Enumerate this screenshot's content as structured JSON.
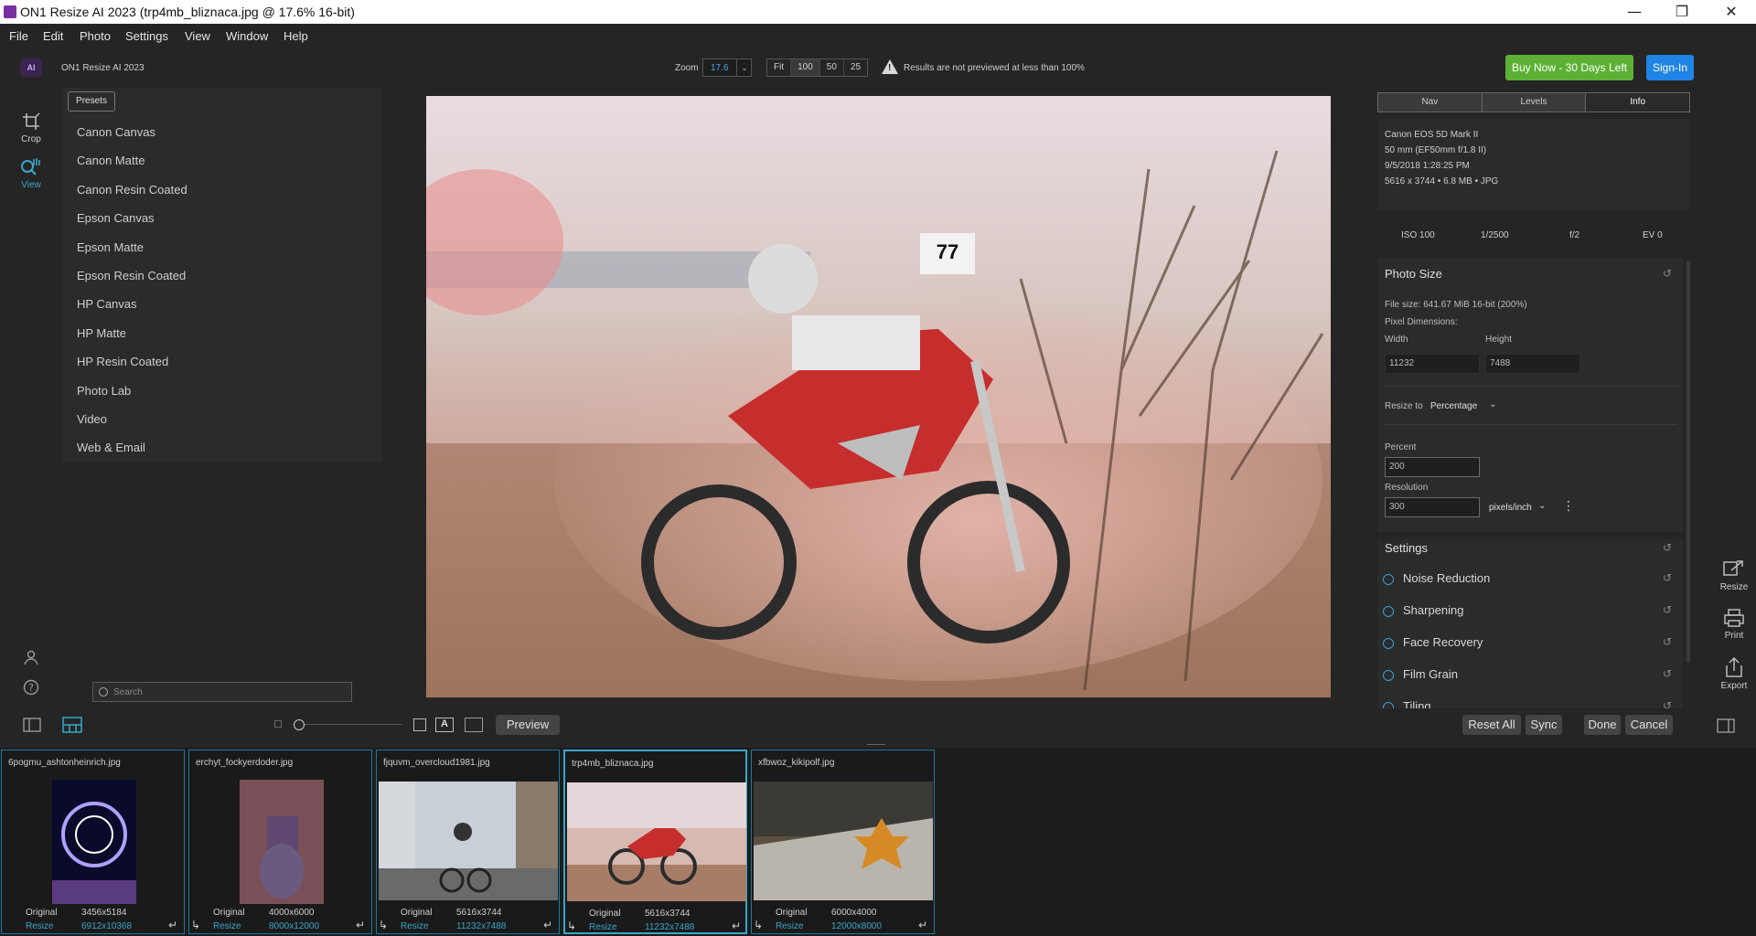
{
  "window": {
    "title": "ON1 Resize AI 2023 (trp4mb_bliznaca.jpg @ 17.6% 16-bit)",
    "minimize": "—",
    "maximize": "❐",
    "close": "✕"
  },
  "menu": [
    "File",
    "Edit",
    "Photo",
    "Settings",
    "View",
    "Window",
    "Help"
  ],
  "toolbar": {
    "app_badge": "AI",
    "app_name": "ON1 Resize AI 2023",
    "zoom_label": "Zoom",
    "zoom_value": "17.6",
    "zoom_presets": [
      "Fit",
      "100",
      "50",
      "25"
    ],
    "warning": "Results are not previewed at less than 100%",
    "buy_now": "Buy Now - 30 Days Left",
    "sign_in": "Sign-In"
  },
  "left_tools": [
    {
      "label": "Crop",
      "icon": "crop-icon"
    },
    {
      "label": "View",
      "icon": "zoom-hand-icon"
    }
  ],
  "presets": {
    "tab": "Presets",
    "items": [
      "Canon Canvas",
      "Canon Matte",
      "Canon Resin Coated",
      "Epson Canvas",
      "Epson Matte",
      "Epson Resin Coated",
      "HP Canvas",
      "HP Matte",
      "HP Resin Coated",
      "Photo Lab",
      "Video",
      "Web & Email"
    ],
    "search_placeholder": "Search"
  },
  "right_panel": {
    "tabs": [
      "Nav",
      "Levels",
      "Info"
    ],
    "info": {
      "camera": "Canon EOS 5D Mark II",
      "lens": "50 mm (EF50mm f/1.8 II)",
      "date": "9/5/2018 1:28:25 PM",
      "dims": "5616 x 3744  •  6.8 MB  •  JPG"
    },
    "exif": [
      "ISO 100",
      "1/2500",
      "f/2",
      "EV 0"
    ],
    "photo_size": {
      "title": "Photo Size",
      "file_size": "File size: 641.67 MiB 16-bit (200%)",
      "pixel_dimensions": "Pixel Dimensions:",
      "width_label": "Width",
      "height_label": "Height",
      "width": "11232",
      "height": "7488",
      "resize_to_label": "Resize to",
      "resize_to_value": "Percentage",
      "percent_label": "Percent",
      "percent": "200",
      "resolution_label": "Resolution",
      "resolution": "300",
      "resolution_unit": "pixels/inch"
    },
    "settings": {
      "title": "Settings",
      "items": [
        "Noise Reduction",
        "Sharpening",
        "Face Recovery",
        "Film Grain",
        "Tiling"
      ]
    }
  },
  "right_tools": [
    "Resize",
    "Print",
    "Export"
  ],
  "bottom": {
    "preview": "Preview",
    "reset_all": "Reset All",
    "sync": "Sync",
    "done": "Done",
    "cancel": "Cancel",
    "text_toggle": "A"
  },
  "filmstrip": [
    {
      "name": "6pogmu_ashtonheinrich.jpg",
      "original_label": "Original",
      "original": "3456x5184",
      "resize_label": "Resize",
      "resize": "6912x10368"
    },
    {
      "name": "erchyt_fockyerdoder.jpg",
      "original_label": "Original",
      "original": "4000x6000",
      "resize_label": "Resize",
      "resize": "8000x12000"
    },
    {
      "name": "fjquvm_overcloud1981.jpg",
      "original_label": "Original",
      "original": "5616x3744",
      "resize_label": "Resize",
      "resize": "11232x7488"
    },
    {
      "name": "trp4mb_bliznaca.jpg",
      "original_label": "Original",
      "original": "5616x3744",
      "resize_label": "Resize",
      "resize": "11232x7488"
    },
    {
      "name": "xfbwoz_kikipolf.jpg",
      "original_label": "Original",
      "original": "6000x4000",
      "resize_label": "Resize",
      "resize": "12000x8000"
    }
  ],
  "colors": {
    "accent": "#3aa6c9",
    "buy": "#5cb135",
    "signin": "#1f84e6",
    "background": "#252525"
  }
}
